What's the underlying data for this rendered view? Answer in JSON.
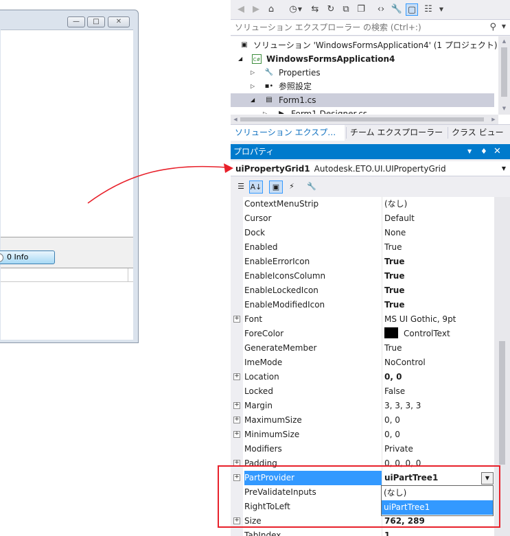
{
  "designer": {
    "info_button_label": "0 Info"
  },
  "toolbar": {
    "icons": [
      "back-icon",
      "forward-icon",
      "home-icon",
      "history-icon",
      "sync-icon",
      "refresh-icon",
      "collapse-icon",
      "copy-icon",
      "code-icon",
      "wrench-icon",
      "preview-icon",
      "diagram-icon"
    ]
  },
  "search": {
    "placeholder": "ソリューション エクスプローラー の検索 (Ctrl+:)"
  },
  "tree": {
    "solution": "ソリューション 'WindowsFormsApplication4' (1 プロジェクト)",
    "project": "WindowsFormsApplication4",
    "properties": "Properties",
    "references": "参照設定",
    "form1": "Form1.cs",
    "form1_designer": "Form1.Designer.cs"
  },
  "tabs": [
    {
      "label": "ソリューション エクスプ…"
    },
    {
      "label": "チーム エクスプローラー"
    },
    {
      "label": "クラス ビュー"
    }
  ],
  "properties_window": {
    "title": "プロパティ",
    "object_name": "uiPropertyGrid1",
    "object_type": "Autodesk.ETO.UI.UIPropertyGrid",
    "rows": [
      {
        "name": "ContextMenuStrip",
        "value": "(なし)"
      },
      {
        "name": "Cursor",
        "value": "Default"
      },
      {
        "name": "Dock",
        "value": "None"
      },
      {
        "name": "Enabled",
        "value": "True"
      },
      {
        "name": "EnableErrorIcon",
        "value": "True"
      },
      {
        "name": "EnableIconsColumn",
        "value": "True"
      },
      {
        "name": "EnableLockedIcon",
        "value": "True"
      },
      {
        "name": "EnableModifiedIcon",
        "value": "True"
      },
      {
        "name": "Font",
        "value": "MS UI Gothic, 9pt"
      },
      {
        "name": "ForeColor",
        "value": "ControlText"
      },
      {
        "name": "GenerateMember",
        "value": "True"
      },
      {
        "name": "ImeMode",
        "value": "NoControl"
      },
      {
        "name": "Location",
        "value": "0, 0"
      },
      {
        "name": "Locked",
        "value": "False"
      },
      {
        "name": "Margin",
        "value": "3, 3, 3, 3"
      },
      {
        "name": "MaximumSize",
        "value": "0, 0"
      },
      {
        "name": "MinimumSize",
        "value": "0, 0"
      },
      {
        "name": "Modifiers",
        "value": "Private"
      },
      {
        "name": "Padding",
        "value": "0, 0, 0, 0"
      },
      {
        "name": "PartProvider",
        "value": "uiPartTree1"
      },
      {
        "name": "PreValidateInputs",
        "value": ""
      },
      {
        "name": "RightToLeft",
        "value": ""
      },
      {
        "name": "Size",
        "value": "762, 289"
      },
      {
        "name": "TabIndex",
        "value": "1"
      }
    ],
    "forecolor_swatch": "#000000",
    "dropdown_options": [
      "(なし)",
      "uiPartTree1"
    ]
  },
  "colors": {
    "accent": "#007acc",
    "selection": "#3399ff",
    "highlight_border": "#e8202a"
  }
}
